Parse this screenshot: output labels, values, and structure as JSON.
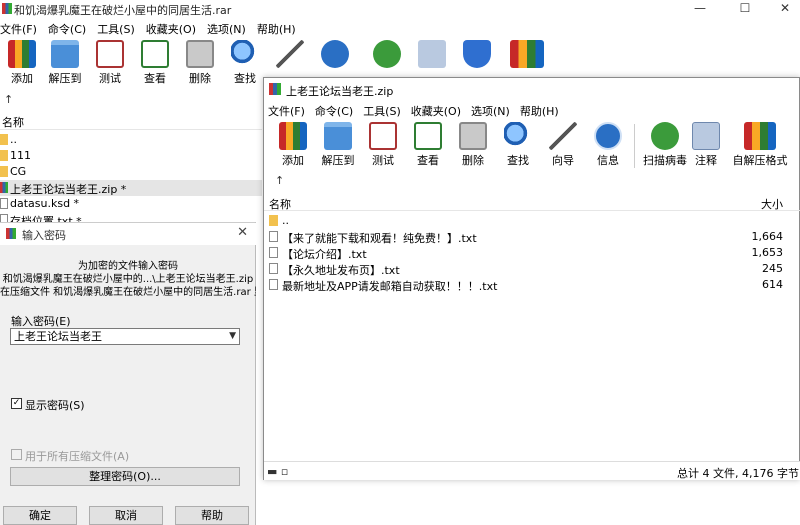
{
  "bg_window": {
    "title": "和饥渴爆乳魔王在破烂小屋中的同居生活.rar",
    "menu": [
      "文件(F)",
      "命令(C)",
      "工具(S)",
      "收藏夹(O)",
      "选项(N)",
      "帮助(H)"
    ],
    "toolbar": [
      "添加",
      "解压到",
      "测试",
      "查看",
      "删除",
      "查找"
    ],
    "up_arrow": "↑",
    "column_name": "名称",
    "items": [
      "..",
      "111",
      "CG",
      "上老王论坛当老王.zip *",
      "datasu.ksd *",
      "存档位置.txt *"
    ]
  },
  "password_dialog": {
    "title": "输入密码",
    "line1": "为加密的文件输入密码",
    "line2": "和饥渴爆乳魔王在破烂小屋中的...\\上老王论坛当老王.zip",
    "line3": "在压缩文件 和饥渴爆乳魔王在破烂小屋中的同居生活.rar 里",
    "password_label": "输入密码(E)",
    "password_value": "上老王论坛当老王",
    "show_password": "显示密码(S)",
    "use_for_all": "用于所有压缩文件(A)",
    "organize": "整理密码(O)...",
    "ok": "确定",
    "cancel": "取消",
    "help": "帮助"
  },
  "fg_window": {
    "title": "上老王论坛当老王.zip",
    "menu": [
      "文件(F)",
      "命令(C)",
      "工具(S)",
      "收藏夹(O)",
      "选项(N)",
      "帮助(H)"
    ],
    "toolbar": [
      "添加",
      "解压到",
      "测试",
      "查看",
      "删除",
      "查找",
      "向导",
      "信息",
      "扫描病毒",
      "注释",
      "自解压格式"
    ],
    "up_arrow": "↑",
    "columns": {
      "name": "名称",
      "size": "大小"
    },
    "files": [
      {
        "name": "..",
        "size": ""
      },
      {
        "name": "【来了就能下载和观看！纯免费！】.txt",
        "size": "1,664"
      },
      {
        "name": "【论坛介绍】.txt",
        "size": "1,653"
      },
      {
        "name": "【永久地址发布页】.txt",
        "size": "245"
      },
      {
        "name": "最新地址及APP请发邮箱自动获取！！！.txt",
        "size": "614"
      }
    ],
    "status": "总计 4 文件, 4,176 字节"
  }
}
